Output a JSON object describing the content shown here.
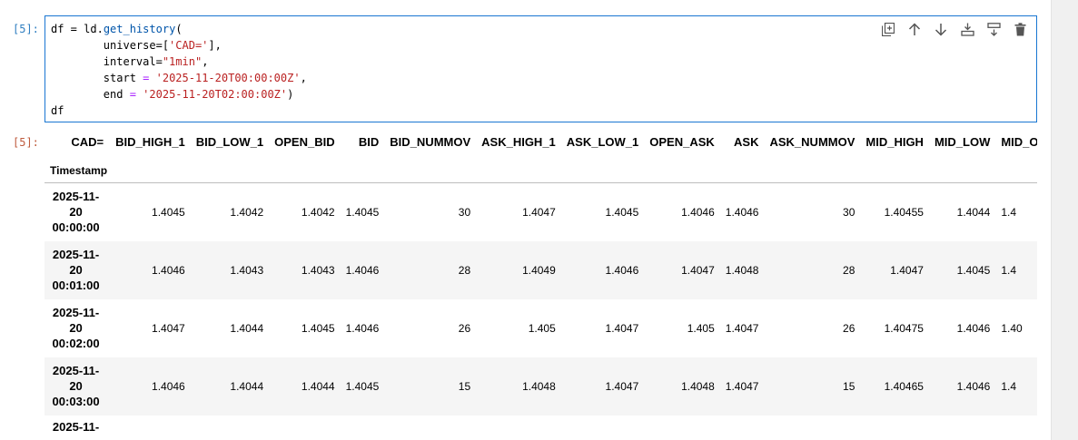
{
  "cell": {
    "input_prompt": "[5]:",
    "output_prompt": "[5]:",
    "code": {
      "l1_var": "df",
      "l1_eq": " = ",
      "l1_obj": "ld.",
      "l1_fn": "get_history",
      "l1_paren": "(",
      "l2_key": "        universe=[",
      "l2_val": "'CAD='",
      "l2_end": "],",
      "l3_key": "        interval=",
      "l3_val": "\"1min\"",
      "l3_end": ",",
      "l4_key": "        start ",
      "l4_eq": "=",
      "l4_sp": " ",
      "l4_val": "'2025-11-20T00:00:00Z'",
      "l4_end": ",",
      "l5_key": "        end ",
      "l5_eq": "=",
      "l5_sp": " ",
      "l5_val": "'2025-11-20T02:00:00Z'",
      "l5_end": ")",
      "l6": "df"
    }
  },
  "toolbar": {
    "icons": [
      "duplicate-icon",
      "move-up-icon",
      "move-down-icon",
      "insert-below-icon",
      "insert-above-icon",
      "delete-icon"
    ]
  },
  "table": {
    "index_header": "CAD=",
    "index_name": "Timestamp",
    "columns": [
      "BID_HIGH_1",
      "BID_LOW_1",
      "OPEN_BID",
      "BID",
      "BID_NUMMOV",
      "ASK_HIGH_1",
      "ASK_LOW_1",
      "OPEN_ASK",
      "ASK",
      "ASK_NUMMOV",
      "MID_HIGH",
      "MID_LOW",
      "MID_OI"
    ],
    "rows": [
      {
        "ts1": "2025-11-",
        "ts2": "20",
        "ts3": "00:00:00",
        "values": [
          "1.4045",
          "1.4042",
          "1.4042",
          "1.4045",
          "30",
          "1.4047",
          "1.4045",
          "1.4046",
          "1.4046",
          "30",
          "1.40455",
          "1.4044",
          "1.4"
        ]
      },
      {
        "ts1": "2025-11-",
        "ts2": "20",
        "ts3": "00:01:00",
        "values": [
          "1.4046",
          "1.4043",
          "1.4043",
          "1.4046",
          "28",
          "1.4049",
          "1.4046",
          "1.4047",
          "1.4048",
          "28",
          "1.4047",
          "1.4045",
          "1.4"
        ]
      },
      {
        "ts1": "2025-11-",
        "ts2": "20",
        "ts3": "00:02:00",
        "values": [
          "1.4047",
          "1.4044",
          "1.4045",
          "1.4046",
          "26",
          "1.405",
          "1.4047",
          "1.405",
          "1.4047",
          "26",
          "1.40475",
          "1.4046",
          "1.40"
        ]
      },
      {
        "ts1": "2025-11-",
        "ts2": "20",
        "ts3": "00:03:00",
        "values": [
          "1.4046",
          "1.4044",
          "1.4044",
          "1.4045",
          "15",
          "1.4048",
          "1.4047",
          "1.4048",
          "1.4047",
          "15",
          "1.40465",
          "1.4046",
          "1.4"
        ]
      },
      {
        "ts1": "2025-11-",
        "ts2": "",
        "ts3": "",
        "values": [
          "",
          "",
          "",
          "",
          "",
          "",
          "",
          "",
          "",
          "",
          "",
          "",
          ""
        ]
      }
    ]
  }
}
